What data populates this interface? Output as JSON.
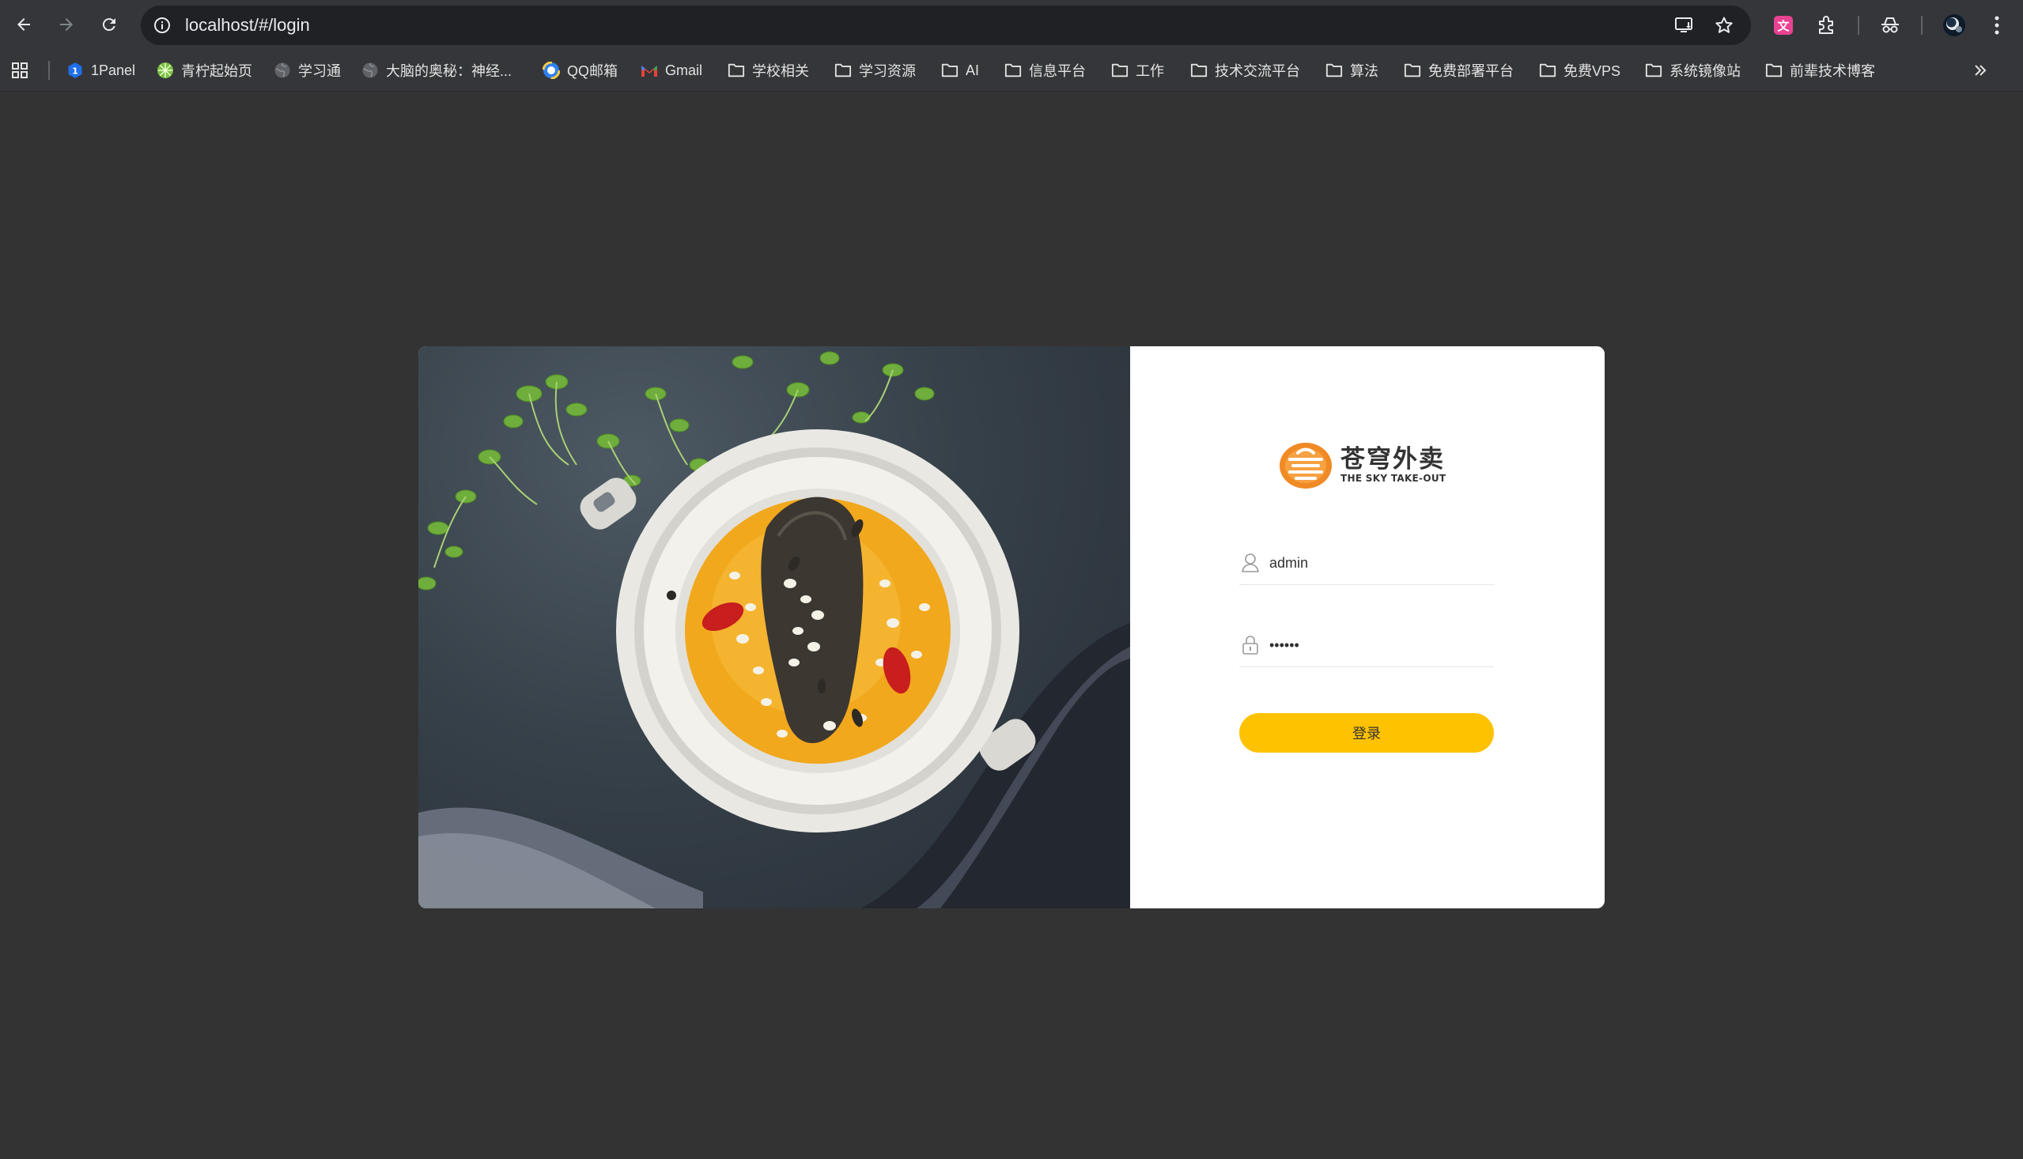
{
  "browser": {
    "url": "localhost/#/login",
    "bookmarks": [
      {
        "label": "1Panel",
        "icon": "1panel-icon"
      },
      {
        "label": "青柠起始页",
        "icon": "lime-icon"
      },
      {
        "label": "学习通",
        "icon": "globe-icon"
      },
      {
        "label": "大脑的奥秘：神经...",
        "icon": "globe-icon"
      },
      {
        "label": "QQ邮箱",
        "icon": "qqmail-icon"
      },
      {
        "label": "Gmail",
        "icon": "gmail-icon"
      },
      {
        "label": "学校相关",
        "icon": "folder-icon"
      },
      {
        "label": "学习资源",
        "icon": "folder-icon"
      },
      {
        "label": "AI",
        "icon": "folder-icon"
      },
      {
        "label": "信息平台",
        "icon": "folder-icon"
      },
      {
        "label": "工作",
        "icon": "folder-icon"
      },
      {
        "label": "技术交流平台",
        "icon": "folder-icon"
      },
      {
        "label": "算法",
        "icon": "folder-icon"
      },
      {
        "label": "免费部署平台",
        "icon": "folder-icon"
      },
      {
        "label": "免费VPS",
        "icon": "folder-icon"
      },
      {
        "label": "系统镜像站",
        "icon": "folder-icon"
      },
      {
        "label": "前辈技术博客",
        "icon": "folder-icon"
      }
    ]
  },
  "login": {
    "logo_cn": "苍穹外卖",
    "logo_en": "THE SKY TAKE-OUT",
    "username": "admin",
    "password": "123456",
    "submit_label": "登录"
  },
  "colors": {
    "page_bg": "#333333",
    "accent": "#ffc200",
    "logo_orange": "#f08a24"
  }
}
